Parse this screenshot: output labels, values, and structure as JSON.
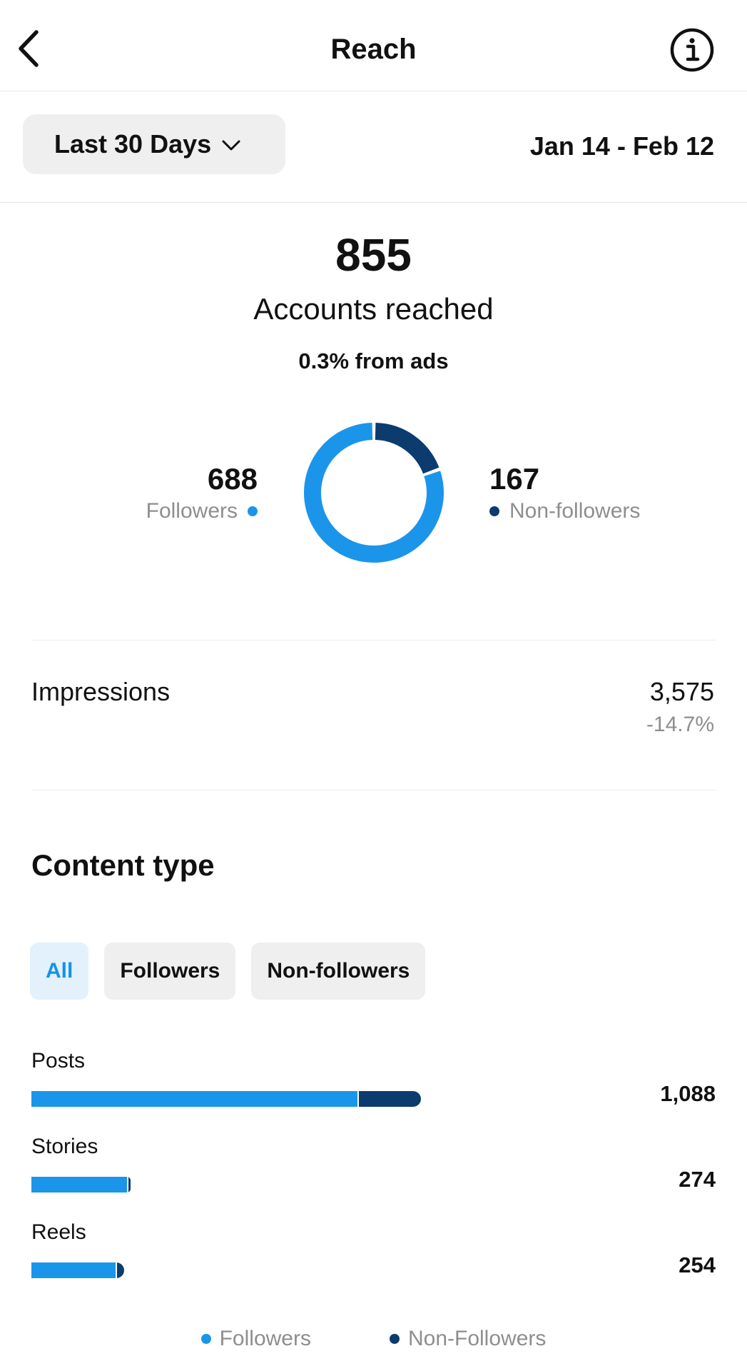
{
  "header": {
    "title": "Reach"
  },
  "date_filter": {
    "range_label": "Last 30 Days",
    "date_range": "Jan 14 - Feb 12"
  },
  "summary": {
    "total": "855",
    "caption": "Accounts reached",
    "ads_text": "0.3% from ads"
  },
  "audience_split": {
    "followers_value": "688",
    "followers_label": "Followers",
    "non_followers_value": "167",
    "non_followers_label": "Non-followers",
    "followers_count": 688,
    "non_followers_count": 167
  },
  "impressions": {
    "label": "Impressions",
    "value": "3,575",
    "change": "-14.7%"
  },
  "content_type": {
    "title": "Content type",
    "filters": [
      "All",
      "Followers",
      "Non-followers"
    ],
    "active_filter": "All",
    "rows": [
      {
        "label": "Posts",
        "value": "1,088",
        "followers_share_of_max": 0.84,
        "non_followers_share_of_max": 0.16
      },
      {
        "label": "Stories",
        "value": "274",
        "followers_share_of_max": 0.246,
        "non_followers_share_of_max": 0.006
      },
      {
        "label": "Reels",
        "value": "254",
        "followers_share_of_max": 0.216,
        "non_followers_share_of_max": 0.018
      }
    ],
    "legend": [
      "Followers",
      "Non-Followers"
    ]
  },
  "colors": {
    "followers": "#1b95ea",
    "non_followers": "#0c3b6e",
    "accent": "#1592e6"
  }
}
